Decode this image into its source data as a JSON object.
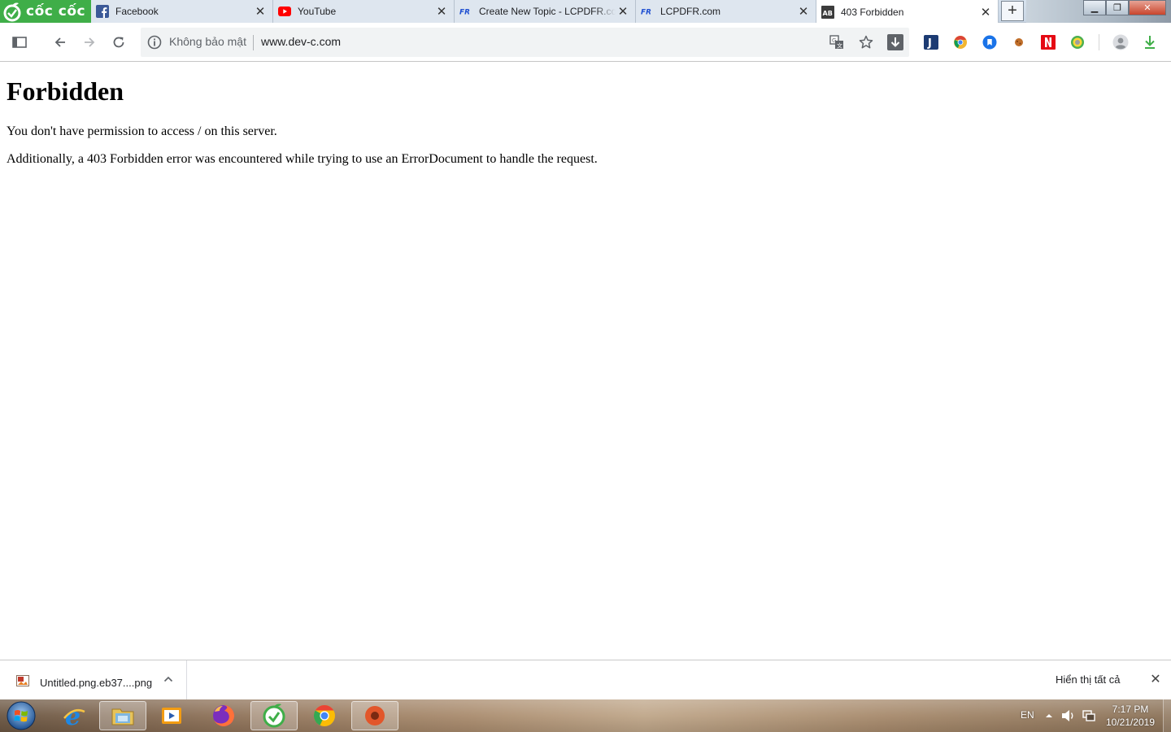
{
  "browser": {
    "brand_name": "cốc cốc",
    "tabs": [
      {
        "title": "Facebook",
        "favicon": "facebook-icon"
      },
      {
        "title": "YouTube",
        "favicon": "youtube-icon"
      },
      {
        "title": "Create New Topic - LCPDFR.com",
        "favicon": "lcpdfr-icon"
      },
      {
        "title": "LCPDFR.com",
        "favicon": "lcpdfr-icon"
      },
      {
        "title": "403 Forbidden",
        "favicon": "ab-icon"
      }
    ],
    "new_tab_label": "+",
    "address_bar": {
      "security_text": "Không bảo mật",
      "url": "www.dev-c.com"
    }
  },
  "page": {
    "heading": "Forbidden",
    "message": "You don't have permission to access / on this server.",
    "detail": "Additionally, a 403 Forbidden error was encountered while trying to use an ErrorDocument to handle the request."
  },
  "downloads": {
    "file_name": "Untitled.png.eb37....png",
    "show_all_label": "Hiển thị tất cả"
  },
  "taskbar": {
    "language": "EN",
    "time": "7:17 PM",
    "date": "10/21/2019"
  },
  "colors": {
    "brand_green": "#3fae48",
    "facebook_blue": "#3b5998",
    "youtube_red": "#ff0000",
    "lcpdfr_blue": "#1f4fd1"
  }
}
